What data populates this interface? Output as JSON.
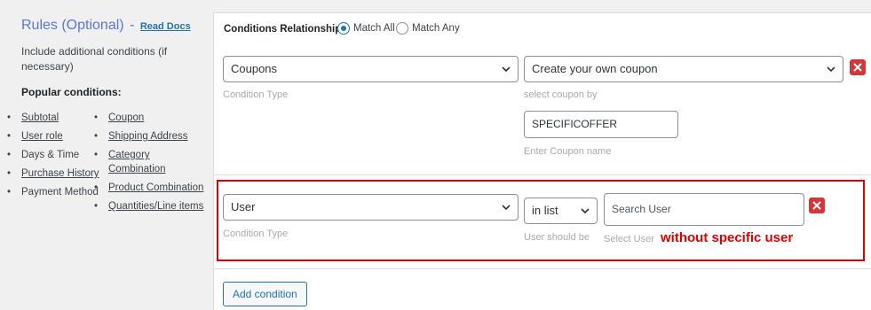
{
  "left": {
    "title": "Rules (Optional)",
    "dash": "-",
    "read_docs": "Read Docs",
    "description": "Include additional conditions (if necessary)",
    "popular_title": "Popular conditions:",
    "col1": [
      {
        "label": "Subtotal",
        "link": true
      },
      {
        "label": "User role",
        "link": true
      },
      {
        "label": "Days & Time",
        "link": false
      },
      {
        "label": "Purchase History",
        "link": true
      },
      {
        "label": "Payment Method",
        "link": false
      }
    ],
    "col2": [
      {
        "label": "Coupon",
        "link": true
      },
      {
        "label": "Shipping Address",
        "link": true
      },
      {
        "label": "Category Combination",
        "link": true
      },
      {
        "label": "Product Combination",
        "link": true
      },
      {
        "label": "Quantities/Line items",
        "link": true
      }
    ]
  },
  "conditions": {
    "relationship_label": "Conditions Relationship",
    "match_all": "Match All",
    "match_any": "Match Any",
    "selected": "match_all"
  },
  "row1": {
    "type_value": "Coupons",
    "type_hint": "Condition Type",
    "coupon_value": "Create your own coupon",
    "coupon_hint": "select coupon by",
    "coupon_name_value": "SPECIFICOFFER",
    "coupon_name_hint": "Enter Coupon name"
  },
  "row2": {
    "type_value": "User",
    "type_hint": "Condition Type",
    "operator_value": "in list",
    "operator_hint": "User should be",
    "search_placeholder": "Search User",
    "search_hint": "Select User"
  },
  "annotation": "without specific user",
  "add_condition": "Add condition",
  "colors": {
    "accent": "#2271b1",
    "title": "#5b76d8",
    "danger": "#d63638",
    "annotation": "#e00000"
  }
}
